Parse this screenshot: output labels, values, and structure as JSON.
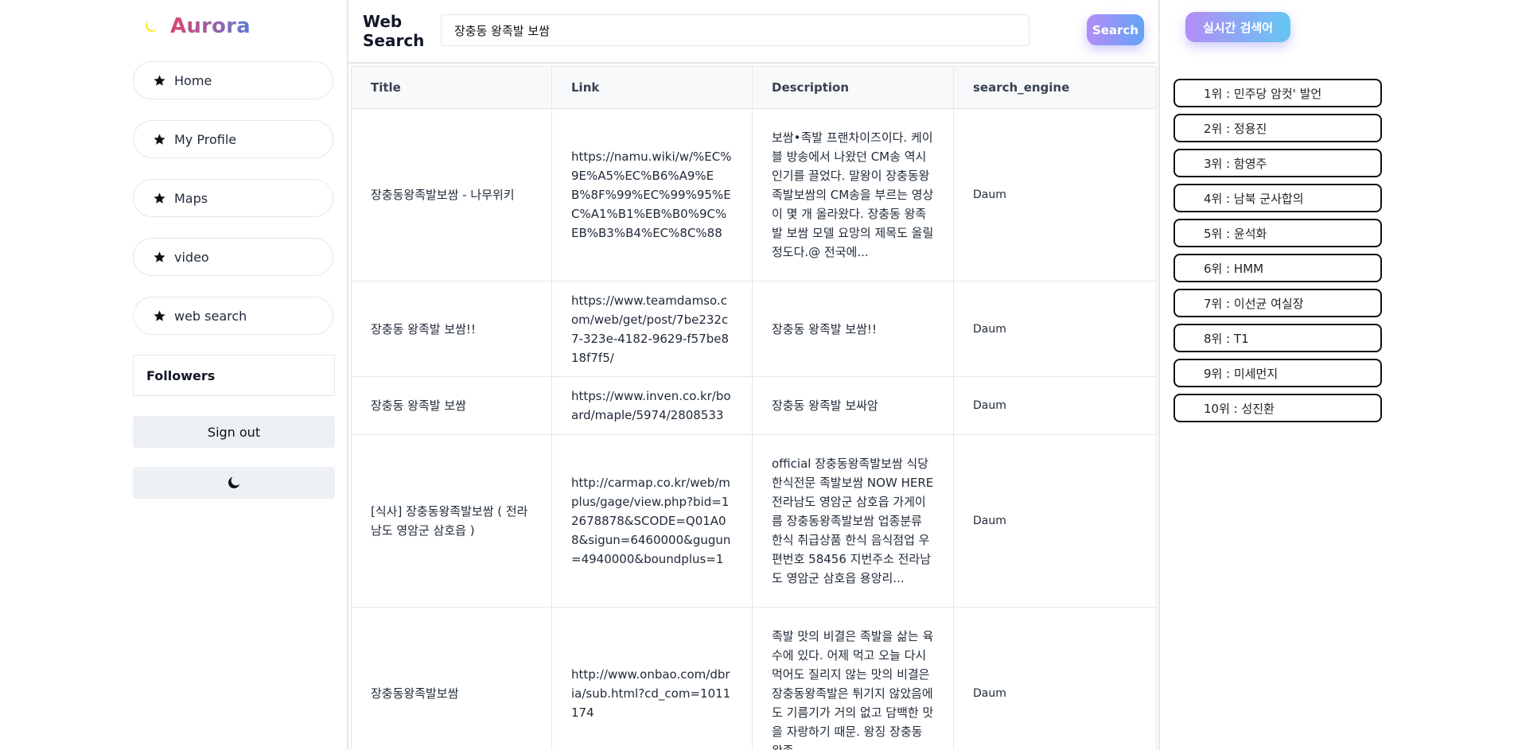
{
  "brand": {
    "name": "Aurora"
  },
  "sidebar": {
    "items": [
      {
        "label": "Home"
      },
      {
        "label": "My Profile"
      },
      {
        "label": "Maps"
      },
      {
        "label": "video"
      },
      {
        "label": "web search"
      }
    ],
    "followers_label": "Followers",
    "signout_label": "Sign out"
  },
  "header": {
    "title": "Web Search",
    "search_value": "장충동 왕족발 보쌈",
    "search_button": "Search"
  },
  "table": {
    "columns": [
      "Title",
      "Link",
      "Description",
      "search_engine"
    ],
    "rows": [
      {
        "title": "장충동왕족발보쌈 - 나무위키",
        "link": "https://namu.wiki/w/%EC%9E%A5%EC%B6%A9%EB%8F%99%EC%99%95%EC%A1%B1%EB%B0%9C%EB%B3%B4%EC%8C%88",
        "description": "보쌈•족발 프랜차이즈이다. 케이블 방송에서 나왔던 CM송 역시 인기를 끌었다. 말왕이 장충동왕족발보쌈의 CM송을 부르는 영상이 몇 개 올라왔다. 장충동 왕족발 보쌈 모델 요망의 제목도 올릴 정도다.@ 전국에...",
        "engine": "Daum"
      },
      {
        "title": "장충동 왕족발 보쌈!!",
        "link": "https://www.teamdamso.com/web/get/post/7be232c7-323e-4182-9629-f57be818f7f5/",
        "description": "장충동 왕족발 보쌈!!",
        "engine": "Daum"
      },
      {
        "title": "장충동 왕족발 보쌈",
        "link": "https://www.inven.co.kr/board/maple/5974/2808533",
        "description": "장충동 왕족발 보싸암",
        "engine": "Daum"
      },
      {
        "title": "[식사] 장충동왕족발보쌈 ( 전라남도 영암군 삼호읍 )",
        "link": "http://carmap.co.kr/web/mplus/gage/view.php?bid=12678878&SCODE=Q01A08&sigun=6460000&gugun=4940000&boundplus=1",
        "description": "official 장충동왕족발보쌈 식당 한식전문 족발보쌈 NOW HERE 전라남도 영암군 삼호읍 가게이름 장충동왕족발보쌈 업종분류 한식 취급상품 한식 음식점업 우편번호 58456 지번주소 전라남도 영암군 삼호읍 용앙리...",
        "engine": "Daum"
      },
      {
        "title": "장충동왕족발보쌈",
        "link": "http://www.onbao.com/dbria/sub.html?cd_com=1011174",
        "description": "족발 맛의 비결은 족발을 삶는 육수에 있다. 어제 먹고 오늘 다시 먹어도 질리지 않는 맛의 비결은 장충동왕족발은 튀기지 않았음에도 기름기가 거의 없고 담백한 맛을 자랑하기 때문. 왕징 장충동 왕족",
        "engine": "Daum"
      }
    ]
  },
  "realtime": {
    "button_label": "실시간 검색어",
    "items": [
      "1위 : 민주당 암컷' 발언",
      "2위 : 정용진",
      "3위 : 함영주",
      "4위 : 남북 군사합의",
      "5위 : 윤석화",
      "6위 : HMM",
      "7위 : 이선균 여실장",
      "8위 : T1",
      "9위 : 미세먼지",
      "10위 : 성진환"
    ]
  },
  "colors": {
    "accent_start": "#b48cf6",
    "accent_end": "#63a4f6",
    "logo_yellow": "#f5e400"
  },
  "icons": {
    "nav": "star-icon",
    "logo": "moon-icon",
    "theme": "moon-icon"
  }
}
